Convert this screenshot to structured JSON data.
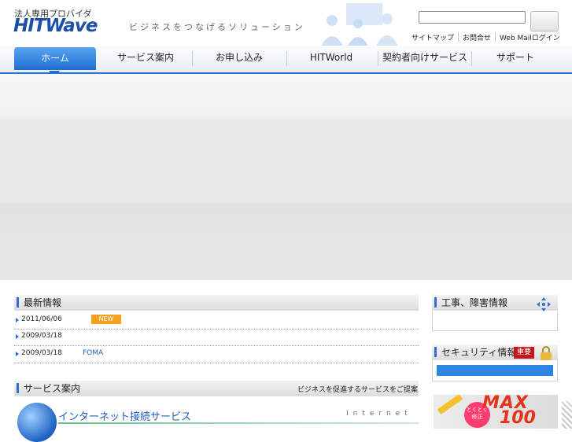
{
  "header": {
    "tagline_top": "法人専用プロバイダ",
    "logo": "HITWave",
    "slogan": "ビジネスをつなげるソリューション",
    "search": {
      "value": "",
      "placeholder": ""
    },
    "util_links": [
      "サイトマップ",
      "お問合せ",
      "Web Mailログイン"
    ]
  },
  "nav": {
    "items": [
      "ホーム",
      "サービス案内",
      "お申し込み",
      "HITWorld",
      "契約者向けサービス",
      "サポート"
    ],
    "active": "ホーム"
  },
  "news": {
    "title": "最新情報",
    "rows": [
      {
        "date": "2011/06/06",
        "badge": "NEW",
        "text": ""
      },
      {
        "date": "2009/03/18",
        "badge": "",
        "text": ""
      },
      {
        "date": "2009/03/18",
        "badge": "",
        "text": "FOMA"
      }
    ]
  },
  "services": {
    "title": "サービス案内",
    "subtitle": "ビジネスを促進するサービスをご提案",
    "internet_title": "インターネット接続サービス",
    "internet_en": "Internet"
  },
  "sidebar": {
    "construction_title": "工事、障害情報",
    "security_title": "セキュリティ情報",
    "security_badge": "重要"
  },
  "promo": {
    "burst": "とくとく修正",
    "max": "MAX",
    "num": "100"
  },
  "colors": {
    "accent": "#2a6fd1",
    "badge_new": "#f5a020",
    "badge_important": "#c0161c"
  }
}
